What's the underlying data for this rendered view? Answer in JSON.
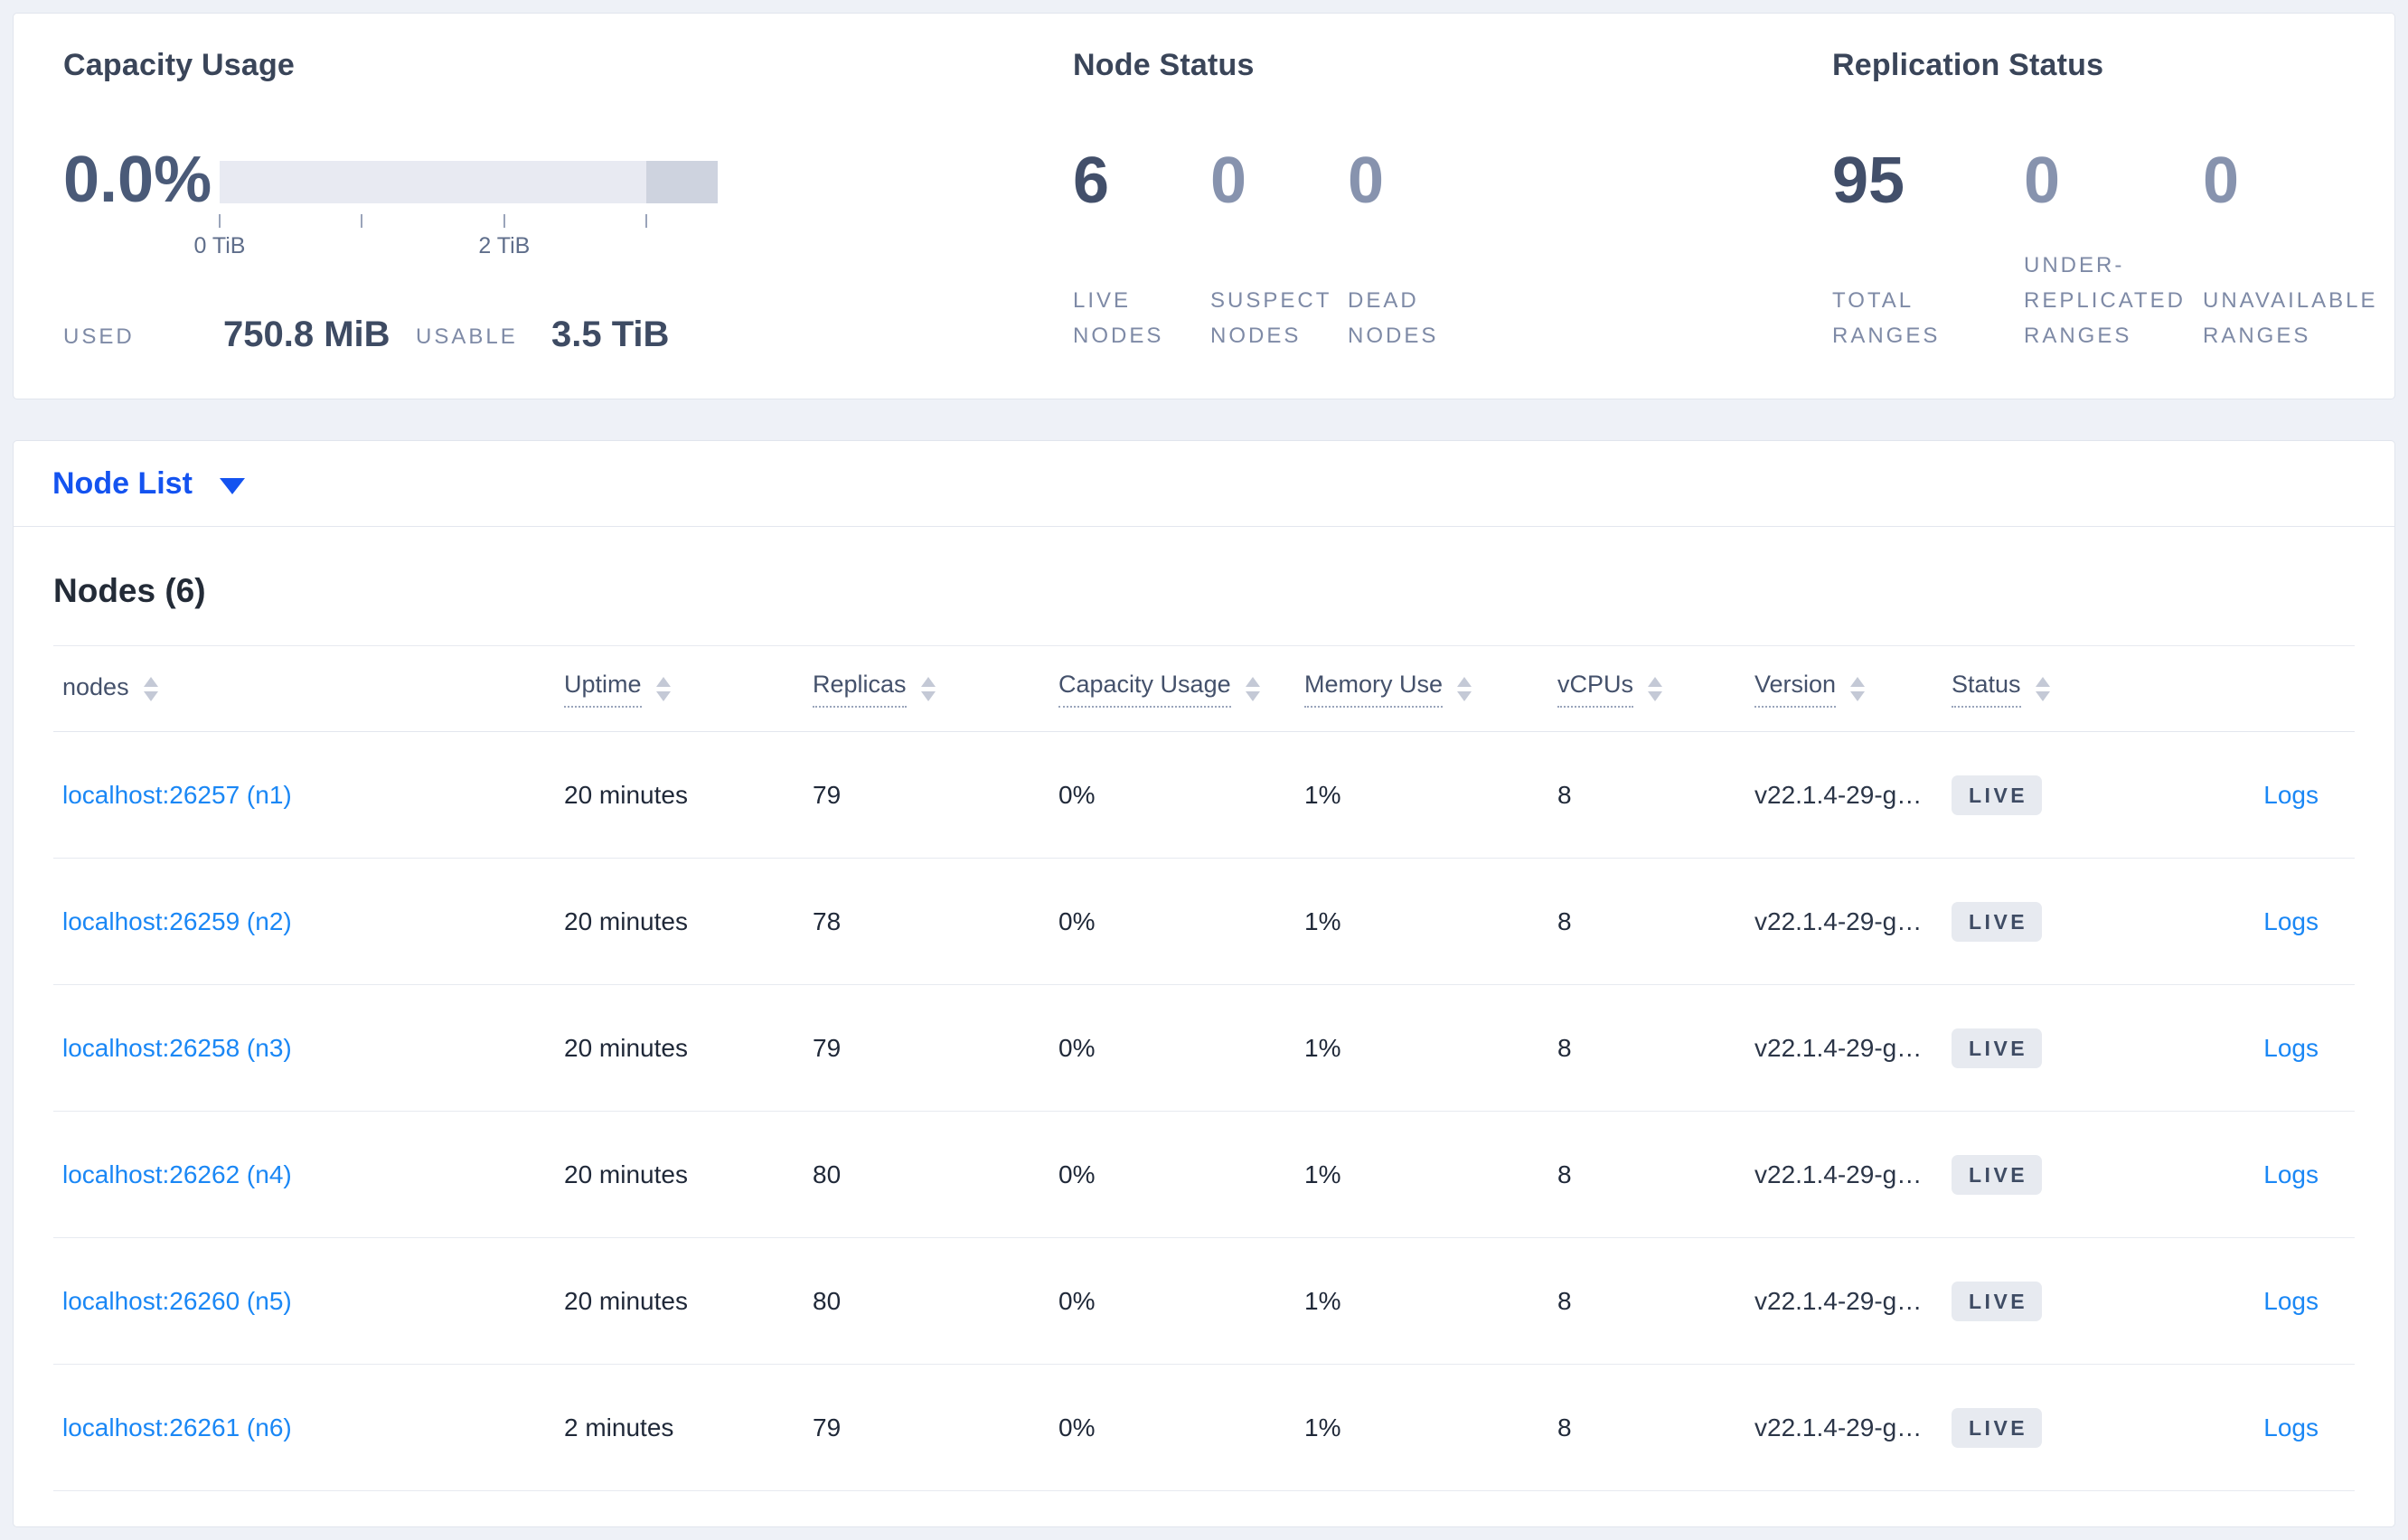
{
  "capacity_usage": {
    "title": "Capacity Usage",
    "percent": "0.0%",
    "bar": {
      "total_tib": 3.5,
      "dark_from_tib": 3.0,
      "ticks": [
        {
          "tib": 0,
          "label": "0 TiB"
        },
        {
          "tib": 1,
          "label": ""
        },
        {
          "tib": 2,
          "label": "2 TiB"
        },
        {
          "tib": 3,
          "label": ""
        }
      ],
      "light_color": "#e8eaf2",
      "dark_color": "#ced3df"
    },
    "used_label": "USED",
    "used_value": "750.8 MiB",
    "usable_label": "USABLE",
    "usable_value": "3.5 TiB"
  },
  "node_status": {
    "title": "Node Status",
    "metrics": [
      {
        "value": "6",
        "label": "LIVE NODES",
        "primary": true
      },
      {
        "value": "0",
        "label": "SUSPECT NODES",
        "primary": false
      },
      {
        "value": "0",
        "label": "DEAD NODES",
        "primary": false
      }
    ]
  },
  "replication_status": {
    "title": "Replication Status",
    "metrics": [
      {
        "value": "95",
        "label": "TOTAL RANGES",
        "primary": true
      },
      {
        "value": "0",
        "label": "UNDER-REPLICATED RANGES",
        "primary": false
      },
      {
        "value": "0",
        "label": "UNAVAILABLE RANGES",
        "primary": false
      }
    ]
  },
  "view_selector": {
    "label": "Node List",
    "caret_icon": "triangle-down"
  },
  "nodes_table": {
    "heading": "Nodes (6)",
    "columns": [
      {
        "label": "nodes",
        "underlined": false
      },
      {
        "label": "Uptime",
        "underlined": true
      },
      {
        "label": "Replicas",
        "underlined": true
      },
      {
        "label": "Capacity Usage",
        "underlined": true
      },
      {
        "label": "Memory Use",
        "underlined": true
      },
      {
        "label": "vCPUs",
        "underlined": true
      },
      {
        "label": "Version",
        "underlined": true
      },
      {
        "label": "Status",
        "underlined": true
      }
    ],
    "rows": [
      {
        "node": "localhost:26257 (n1)",
        "uptime": "20 minutes",
        "replicas": "79",
        "capacity_usage": "0%",
        "memory_use": "1%",
        "vcpus": "8",
        "version": "v22.1.4-29-g…",
        "status": "LIVE",
        "logs": "Logs"
      },
      {
        "node": "localhost:26259 (n2)",
        "uptime": "20 minutes",
        "replicas": "78",
        "capacity_usage": "0%",
        "memory_use": "1%",
        "vcpus": "8",
        "version": "v22.1.4-29-g…",
        "status": "LIVE",
        "logs": "Logs"
      },
      {
        "node": "localhost:26258 (n3)",
        "uptime": "20 minutes",
        "replicas": "79",
        "capacity_usage": "0%",
        "memory_use": "1%",
        "vcpus": "8",
        "version": "v22.1.4-29-g…",
        "status": "LIVE",
        "logs": "Logs"
      },
      {
        "node": "localhost:26262 (n4)",
        "uptime": "20 minutes",
        "replicas": "80",
        "capacity_usage": "0%",
        "memory_use": "1%",
        "vcpus": "8",
        "version": "v22.1.4-29-g…",
        "status": "LIVE",
        "logs": "Logs"
      },
      {
        "node": "localhost:26260 (n5)",
        "uptime": "20 minutes",
        "replicas": "80",
        "capacity_usage": "0%",
        "memory_use": "1%",
        "vcpus": "8",
        "version": "v22.1.4-29-g…",
        "status": "LIVE",
        "logs": "Logs"
      },
      {
        "node": "localhost:26261 (n6)",
        "uptime": "2 minutes",
        "replicas": "79",
        "capacity_usage": "0%",
        "memory_use": "1%",
        "vcpus": "8",
        "version": "v22.1.4-29-g…",
        "status": "LIVE",
        "logs": "Logs"
      }
    ]
  },
  "colors": {
    "page_background": "#eef1f7",
    "selector_blue": "#1453f0",
    "link_blue": "#1a87f5",
    "badge_background": "#e7eaf0",
    "badge_text": "#3f4c64",
    "bar_light": "#e8eaf2",
    "bar_dark": "#ced3df",
    "primary_number": "#424f6a",
    "secondary_number": "#8793ae"
  }
}
